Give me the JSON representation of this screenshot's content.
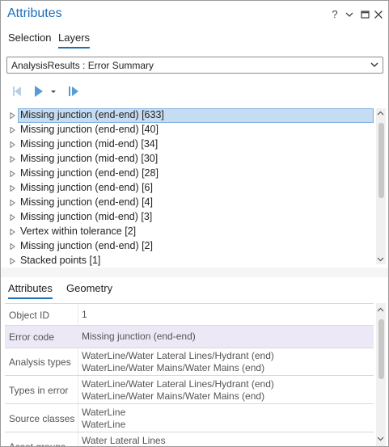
{
  "window": {
    "title": "Attributes",
    "controls": {
      "help": "?",
      "menu": "⌵",
      "restore": "□",
      "close": "✕"
    }
  },
  "top_tabs": [
    {
      "label": "Selection",
      "active": false
    },
    {
      "label": "Layers",
      "active": true
    }
  ],
  "layer_dropdown": {
    "value": "AnalysisResults : Error Summary"
  },
  "tree": {
    "items": [
      {
        "label": "Missing junction (end-end) [633]",
        "selected": true
      },
      {
        "label": "Missing junction (end-end) [40]"
      },
      {
        "label": "Missing junction (mid-end) [34]"
      },
      {
        "label": "Missing junction (mid-end) [30]"
      },
      {
        "label": "Missing junction (end-end) [28]"
      },
      {
        "label": "Missing junction (end-end) [6]"
      },
      {
        "label": "Missing junction (end-end) [4]"
      },
      {
        "label": "Missing junction (mid-end) [3]"
      },
      {
        "label": "Vertex within tolerance [2]"
      },
      {
        "label": "Missing junction (end-end) [2]"
      },
      {
        "label": "Stacked points [1]"
      }
    ]
  },
  "bottom_tabs": [
    {
      "label": "Attributes",
      "active": true
    },
    {
      "label": "Geometry",
      "active": false
    }
  ],
  "attributes": [
    {
      "key": "Object ID",
      "values": [
        "1"
      ]
    },
    {
      "key": "Error code",
      "values": [
        "Missing junction (end-end)"
      ],
      "highlight": true
    },
    {
      "key": "Analysis types",
      "values": [
        "WaterLine/Water Lateral Lines/Hydrant (end)",
        "WaterLine/Water Mains/Water Mains (end)"
      ]
    },
    {
      "key": "Types in error",
      "values": [
        "WaterLine/Water Lateral Lines/Hydrant (end)",
        "WaterLine/Water Mains/Water Mains (end)"
      ]
    },
    {
      "key": "Source classes",
      "values": [
        "WaterLine",
        "WaterLine"
      ]
    },
    {
      "key": "Asset groups",
      "values": [
        "Water Lateral Lines"
      ]
    }
  ],
  "colors": {
    "accent": "#1d6fb8",
    "selection": "#c6dcf2",
    "row_highlight": "#ece8f6",
    "nav_icon": "#5b9bd5",
    "nav_icon_disabled": "#b7cfe8"
  }
}
